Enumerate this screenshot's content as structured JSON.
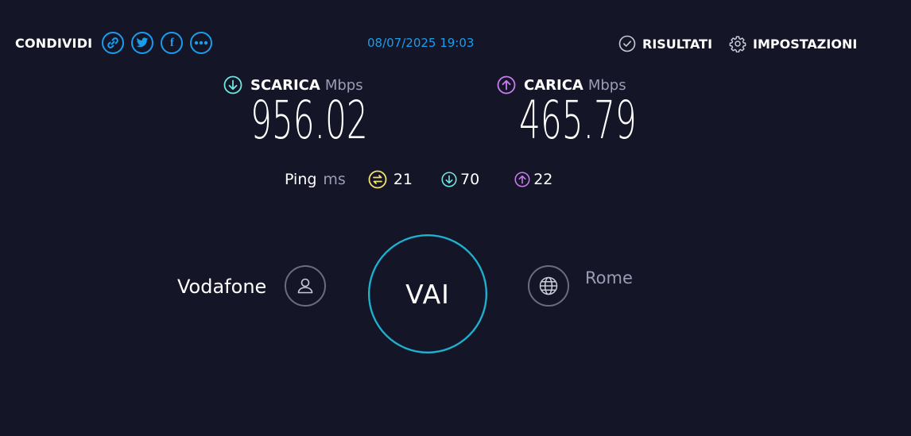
{
  "header": {
    "share_label": "CONDIVIDI",
    "share_icons": [
      "link-icon",
      "twitter-icon",
      "facebook-icon",
      "more-icon"
    ],
    "facebook_glyph": "f",
    "datetime": "08/07/2025 19:03",
    "results_label": "RISULTATI",
    "settings_label": "IMPOSTAZIONI"
  },
  "download": {
    "label": "SCARICA",
    "unit": "Mbps",
    "value": "956.02",
    "icon": "arrow-down-circle-icon"
  },
  "upload": {
    "label": "CARICA",
    "unit": "Mbps",
    "value": "465.79",
    "icon": "arrow-up-circle-icon"
  },
  "ping": {
    "label": "Ping",
    "unit": "ms",
    "idle": "21",
    "download": "70",
    "upload": "22"
  },
  "bottom": {
    "isp": "Vodafone",
    "go_label": "VAI",
    "server": "Rome"
  },
  "colors": {
    "background": "#141526",
    "accent_blue": "#1a9dec",
    "download": "#6ee6e1",
    "upload": "#c67cf0",
    "ping": "#f4e36a",
    "muted": "#9b9db5",
    "ring": "#1fb7c9"
  }
}
